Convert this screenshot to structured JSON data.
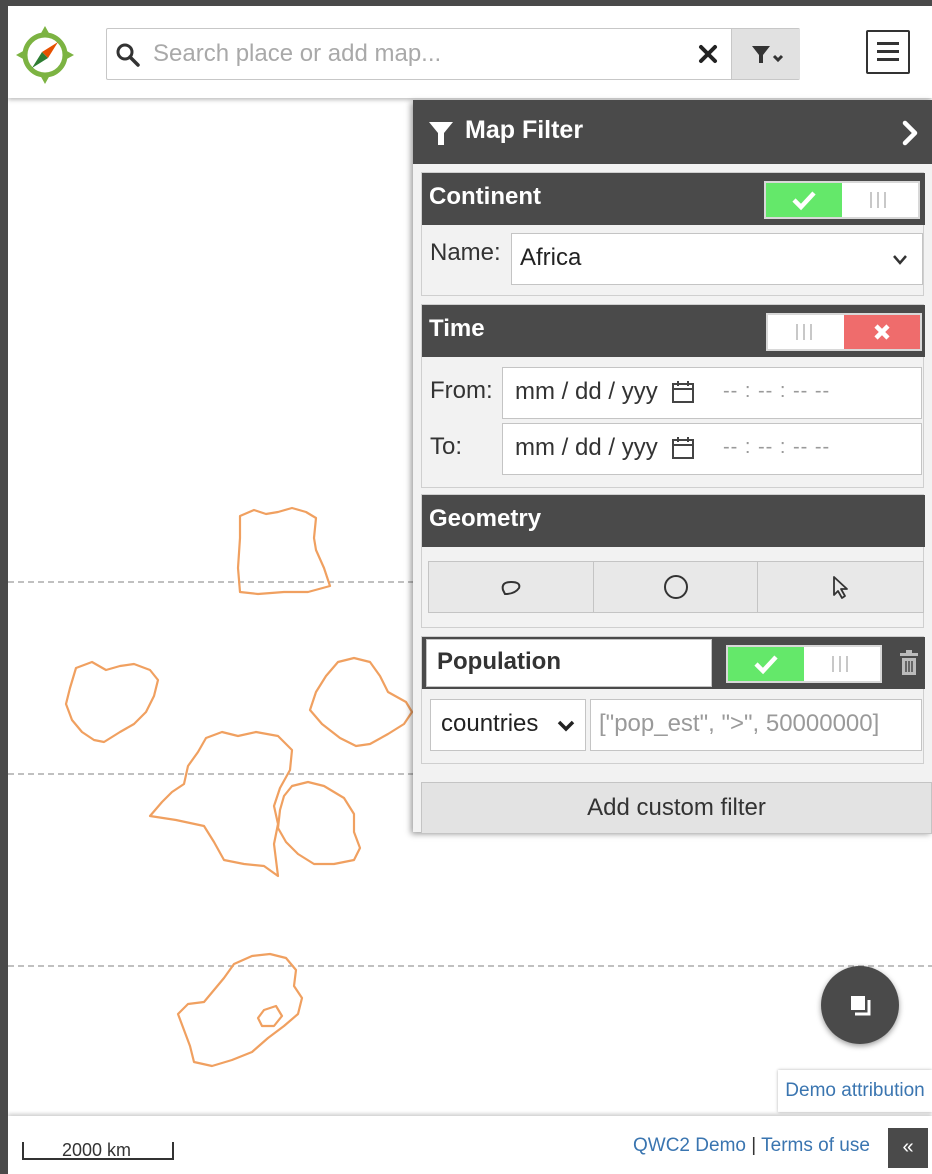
{
  "search": {
    "placeholder": "Search place or add map..."
  },
  "panel": {
    "title": "Map Filter",
    "continent": {
      "title": "Continent",
      "enabled": true,
      "name_label": "Name:",
      "name_value": "Africa"
    },
    "time": {
      "title": "Time",
      "enabled": false,
      "from_label": "From:",
      "to_label": "To:",
      "date_placeholder": "mm / dd / yyy",
      "time_placeholder": "-- : -- : --  --"
    },
    "geometry": {
      "title": "Geometry",
      "tools": [
        "polygon-tool",
        "circle-tool",
        "pick-tool"
      ]
    },
    "population": {
      "title": "Population",
      "enabled": true,
      "layer": "countries",
      "expression_placeholder": "[\"pop_est\", \">\", 50000000]"
    },
    "add_custom_filter": "Add custom filter"
  },
  "colors": {
    "toggle_on": "#64e86a",
    "toggle_off": "#ef6c6c",
    "panel_header": "#4a4a4a",
    "country_outline": "#f0a060",
    "link": "#3a75b0"
  },
  "map": {
    "attribution": "Demo attribution",
    "scale_label": "2000 km"
  },
  "footer": {
    "app_link": "QWC2 Demo",
    "separator": "|",
    "terms_link": "Terms of use",
    "collapse_label": "«"
  }
}
